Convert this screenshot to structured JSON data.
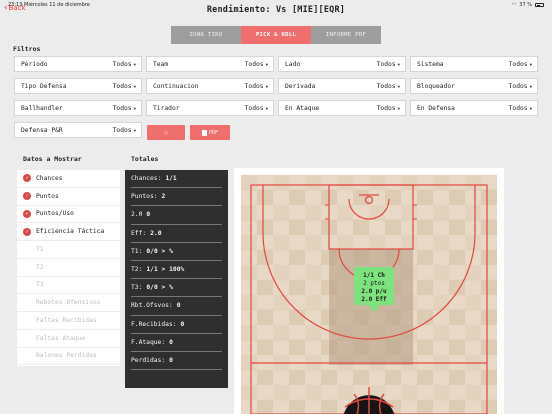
{
  "status": {
    "time": "23:13",
    "date": "Miércoles 11 de diciembre",
    "battery": "37 %"
  },
  "header": {
    "back_label": "Back",
    "title": "Rendimiento: Vs [MIE][EQR]"
  },
  "tabs": [
    {
      "label": "ZONA TIRO",
      "active": false
    },
    {
      "label": "PICK & ROLL",
      "active": true
    },
    {
      "label": "INFORME PDF",
      "active": false
    }
  ],
  "filters": {
    "section_label": "Filtros",
    "items": [
      {
        "label": "Periodo",
        "value": "Todos"
      },
      {
        "label": "Team",
        "value": "Todos"
      },
      {
        "label": "Lado",
        "value": "Todos"
      },
      {
        "label": "Sistema",
        "value": "Todos"
      },
      {
        "label": "Tipo Defensa",
        "value": "Todos"
      },
      {
        "label": "Continuacion",
        "value": "Todos"
      },
      {
        "label": "Derivada",
        "value": "Todos"
      },
      {
        "label": "Bloqueador",
        "value": "Todos"
      },
      {
        "label": "Ballhandler",
        "value": "Todos"
      },
      {
        "label": "Tirador",
        "value": "Todos"
      },
      {
        "label": "En Ataque",
        "value": "Todos"
      },
      {
        "label": "En Defensa",
        "value": "Todos"
      },
      {
        "label": "Defensa P&R",
        "value": "Todos"
      }
    ],
    "clear_glyph": "○",
    "pdf_label": "PDF"
  },
  "datos": {
    "section_label": "Datos a Mostrar",
    "items": [
      {
        "label": "Chances",
        "checked": true
      },
      {
        "label": "Puntos",
        "checked": true
      },
      {
        "label": "Puntos/Uso",
        "checked": true
      },
      {
        "label": "Eficiencia Táctica",
        "checked": true
      },
      {
        "label": "T1",
        "checked": false
      },
      {
        "label": "T2",
        "checked": false
      },
      {
        "label": "T3",
        "checked": false
      },
      {
        "label": "Rebotes Ofensivos",
        "checked": false
      },
      {
        "label": "Faltas Recibidas",
        "checked": false
      },
      {
        "label": "Faltas Ataque",
        "checked": false
      },
      {
        "label": "Balones Perdidos",
        "checked": false
      }
    ]
  },
  "totales": {
    "section_label": "Totales",
    "rows": [
      {
        "label": "Chances:",
        "value": "1/1"
      },
      {
        "label": "Puntos:",
        "value": "2"
      },
      {
        "label": "2.0",
        "value": "0"
      },
      {
        "label": "Eff:",
        "value": "2.0"
      },
      {
        "label": "T1:",
        "value": "0/0 > %"
      },
      {
        "label": "T2:",
        "value": "1/1 > 100%"
      },
      {
        "label": "T3:",
        "value": "0/0 > %"
      },
      {
        "label": "Rbt.Ofsvos:",
        "value": "0"
      },
      {
        "label": "F.Recibidas:",
        "value": "0"
      },
      {
        "label": "F.Ataque:",
        "value": "0"
      },
      {
        "label": "Perdidas:",
        "value": "0"
      }
    ]
  },
  "court": {
    "tooltip": [
      "1/1 Ch",
      "2 ptos",
      "2.0 p/u",
      "2.0 Eff"
    ],
    "line_color": "#e4473f",
    "tooltip_color": "#7ee27e"
  }
}
